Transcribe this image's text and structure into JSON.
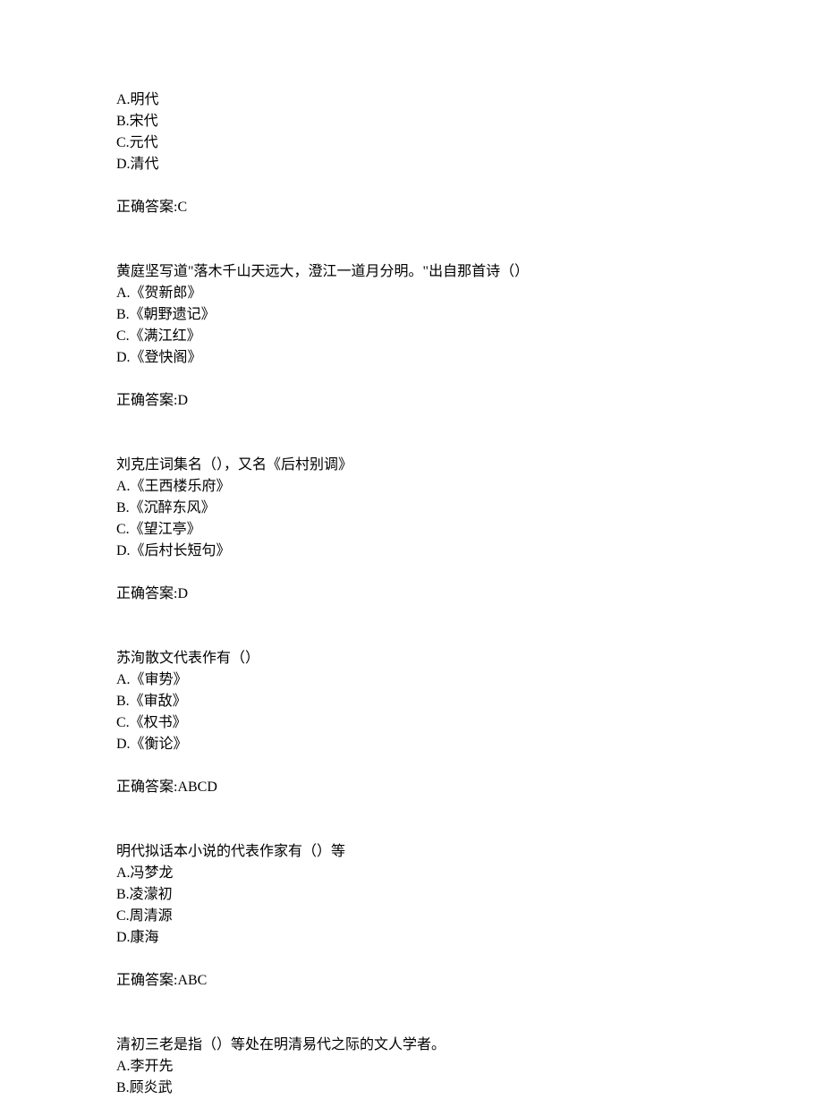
{
  "questions": [
    {
      "text": "",
      "options": [
        "A.明代",
        "B.宋代",
        "C.元代",
        "D.清代"
      ],
      "answer": "正确答案:C"
    },
    {
      "text": "黄庭坚写道\"落木千山天远大，澄江一道月分明。\"出自那首诗（）",
      "options": [
        "A.《贺新郎》",
        "B.《朝野遗记》",
        "C.《满江红》",
        "D.《登快阁》"
      ],
      "answer": "正确答案:D"
    },
    {
      "text": "刘克庄词集名（），又名《后村别调》",
      "options": [
        "A.《王西楼乐府》",
        "B.《沉醉东风》",
        "C.《望江亭》",
        "D.《后村长短句》"
      ],
      "answer": "正确答案:D"
    },
    {
      "text": "苏洵散文代表作有（）",
      "options": [
        "A.《审势》",
        "B.《审敌》",
        "C.《权书》",
        "D.《衡论》"
      ],
      "answer": "正确答案:ABCD"
    },
    {
      "text": "明代拟话本小说的代表作家有（）等",
      "options": [
        "A.冯梦龙",
        "B.凌濛初",
        "C.周清源",
        "D.康海"
      ],
      "answer": "正确答案:ABC"
    },
    {
      "text": "清初三老是指（）等处在明清易代之际的文人学者。",
      "options": [
        "A.李开先",
        "B.顾炎武"
      ],
      "answer": ""
    }
  ]
}
